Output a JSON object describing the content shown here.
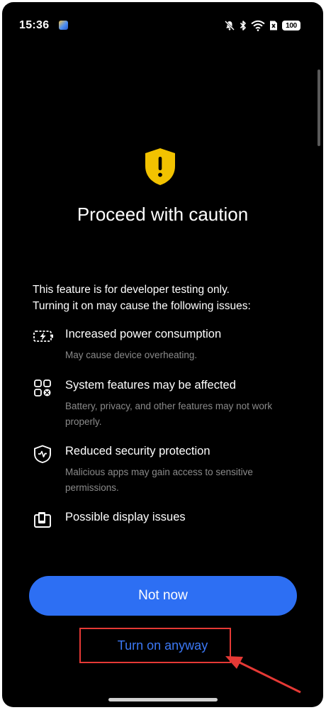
{
  "status_bar": {
    "time": "15:36",
    "battery": "100",
    "icons": [
      "app-notification-icon",
      "mute-icon",
      "bluetooth-icon",
      "wifi-icon",
      "sim-icon",
      "battery-icon"
    ]
  },
  "dialog": {
    "icon": "warning-shield-icon",
    "title": "Proceed with caution",
    "intro_line1": "This feature is for developer testing only.",
    "intro_line2": "Turning it on may cause the following issues:",
    "issues": [
      {
        "icon": "power-icon",
        "title": "Increased power consumption",
        "subtitle": "May cause device overheating."
      },
      {
        "icon": "system-features-icon",
        "title": "System features may be affected",
        "subtitle": "Battery, privacy, and other features may not work properly."
      },
      {
        "icon": "security-shield-icon",
        "title": "Reduced security protection",
        "subtitle": "Malicious apps may gain access to sensitive permissions."
      },
      {
        "icon": "display-icon",
        "title": "Possible display issues",
        "subtitle": ""
      }
    ],
    "primary_button": "Not now",
    "secondary_button": "Turn on anyway"
  },
  "colors": {
    "background": "#000000",
    "primary": "#2d6ff3",
    "link": "#3b78f5",
    "warning": "#f2c200",
    "annotation": "#e53935"
  }
}
